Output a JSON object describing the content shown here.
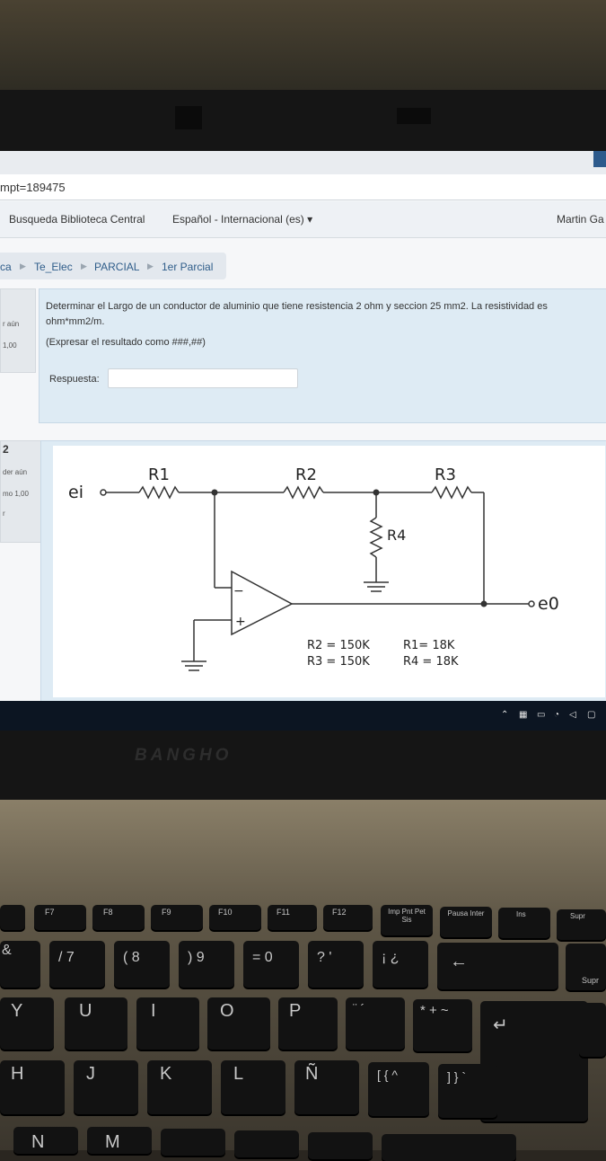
{
  "browser": {
    "url_fragment": "mpt=189475"
  },
  "navbar": {
    "items": [
      "Busqueda Biblioteca Central",
      "Español - Internacional (es) ▾"
    ],
    "user": "Martin Ga"
  },
  "breadcrumb": [
    "ca",
    "Te_Elec",
    "PARCIAL",
    "1er Parcial"
  ],
  "question1": {
    "side": [
      "r aún",
      "1,00"
    ],
    "text_line1": "Determinar el Largo de un conductor de aluminio que tiene resistencia 2 ohm y seccion 25 mm2. La resistividad es",
    "text_line2": "ohm*mm2/m.",
    "format_hint": "(Expresar el resultado como ###,##)",
    "answer_label": "Respuesta:",
    "answer_value": ""
  },
  "question2": {
    "side_number": "2",
    "side": [
      "der aún",
      "mo 1,00",
      "r"
    ],
    "circuit": {
      "input_label": "ei",
      "output_label": "e0",
      "r1": "R1",
      "r2": "R2",
      "r3": "R3",
      "r4": "R4",
      "minus": "−",
      "plus": "+",
      "values": [
        "R2 = 150K",
        "R3 = 150K",
        "R1= 18K",
        "R4 = 18K"
      ]
    }
  },
  "laptop": {
    "brand": "BANGHO"
  },
  "keyboard": {
    "fkeys": [
      "F7",
      "F8",
      "F9",
      "F10",
      "F11",
      "F12",
      "Imp Pnt Pet Sis",
      "Pausa Inter",
      "Ins",
      "Supr"
    ],
    "num_row": [
      "&",
      "/ 7",
      "( 8",
      ") 9",
      "= 0",
      "? '",
      "¡ ¿",
      "←"
    ],
    "row2": [
      "Y",
      "U",
      "I",
      "O",
      "P",
      "¨ ´",
      "* + ~",
      "↵"
    ],
    "row3": [
      "H",
      "J",
      "K",
      "L",
      "Ñ",
      "[ { ^",
      "] } `"
    ],
    "row4": [
      "N",
      "M"
    ],
    "side_label": "Supr"
  }
}
